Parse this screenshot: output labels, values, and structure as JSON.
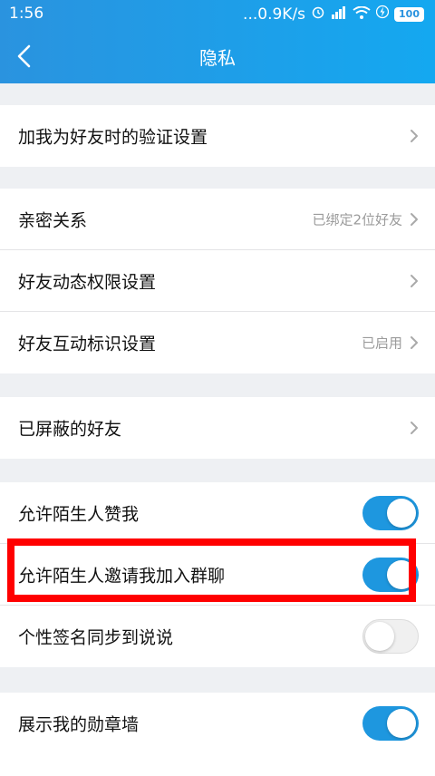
{
  "status": {
    "time": "1:56",
    "network_speed": "...0.9K/s",
    "battery": "100"
  },
  "nav": {
    "title": "隐私"
  },
  "groups": [
    {
      "rows": [
        {
          "label": "加我为好友时的验证设置",
          "type": "link"
        }
      ]
    },
    {
      "rows": [
        {
          "label": "亲密关系",
          "value": "已绑定2位好友",
          "type": "link"
        },
        {
          "label": "好友动态权限设置",
          "type": "link"
        },
        {
          "label": "好友互动标识设置",
          "value": "已启用",
          "type": "link"
        }
      ]
    },
    {
      "rows": [
        {
          "label": "已屏蔽的好友",
          "type": "link"
        }
      ]
    },
    {
      "rows": [
        {
          "label": "允许陌生人赞我",
          "type": "toggle",
          "on": true
        },
        {
          "label": "允许陌生人邀请我加入群聊",
          "type": "toggle",
          "on": true
        },
        {
          "label": "个性签名同步到说说",
          "type": "toggle",
          "on": false
        }
      ]
    },
    {
      "rows": [
        {
          "label": "展示我的勋章墙",
          "type": "toggle",
          "on": true
        }
      ]
    }
  ],
  "colors": {
    "header_start": "#2a93df",
    "header_end": "#14a8f0",
    "toggle_on": "#1e97df",
    "highlight": "#ff0000"
  }
}
